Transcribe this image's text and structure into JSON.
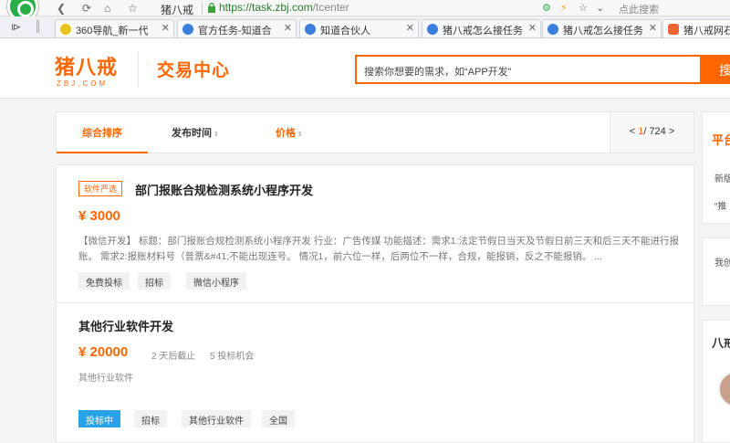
{
  "browser": {
    "site_name": "猪八戒",
    "url_host": "https://task.zbj.com",
    "url_path": "/tcenter",
    "search_placeholder": "点此搜索",
    "tabs": [
      {
        "title": "360导航_新一代",
        "favicon_color": "#e8c21f"
      },
      {
        "title": "官方任务-知道合",
        "favicon_color": "#3b7ddd"
      },
      {
        "title": "知道合伙人",
        "favicon_color": "#3b7ddd"
      },
      {
        "title": "猪八戒怎么接任务",
        "favicon_color": "#3b7ddd"
      },
      {
        "title": "猪八戒怎么接任务",
        "favicon_color": "#3b7ddd"
      },
      {
        "title": "猪八戒网石",
        "favicon_color": "#f0642d"
      }
    ]
  },
  "header": {
    "brand_name": "猪八戒",
    "brand_domain": "ZBJ.COM",
    "page_title": "交易中心",
    "search_placeholder": "搜索你想要的需求，如“APP开发”",
    "search_button": "搜"
  },
  "filters": {
    "items": [
      "综合排序",
      "发布时间",
      "价格"
    ],
    "active_index": 0,
    "page_current": "1",
    "page_total": "/ 724",
    "page_prev": "<",
    "page_next": ">"
  },
  "tasks": [
    {
      "badge": "软件严选",
      "title": "部门报账合规检测系统小程序开发",
      "price": "¥ 3000",
      "description": "【微信开发】 标题：部门报账合规检测系统小程序开发 行业：广告传媒 功能描述：需求1:法定节假日当天及节假日前三天和后三天不能进行报账。 需求2:报账材料号（普票&#41;不能出现连号。 情况1，前六位一样，后两位不一样，合规，能报销，反之不能报销。 ...",
      "tags": [
        "免费投标",
        "招标",
        "微信小程序"
      ]
    },
    {
      "title": "其他行业软件开发",
      "price": "¥ 20000",
      "deadline": "2 天后截止",
      "bids": "5 投标机会",
      "category": "其他行业软件",
      "status_tag": "投标中",
      "tags": [
        "招标",
        "其他行业软件",
        "全国"
      ]
    }
  ],
  "sidebar": {
    "panel1_heading": "平台",
    "panel1_line1": "新版",
    "panel1_line2": "“推",
    "panel2_line1": "我创",
    "panel3_heading": "八戒"
  },
  "colors": {
    "accent": "#ff6600",
    "tag_blue": "#29a3e8"
  }
}
